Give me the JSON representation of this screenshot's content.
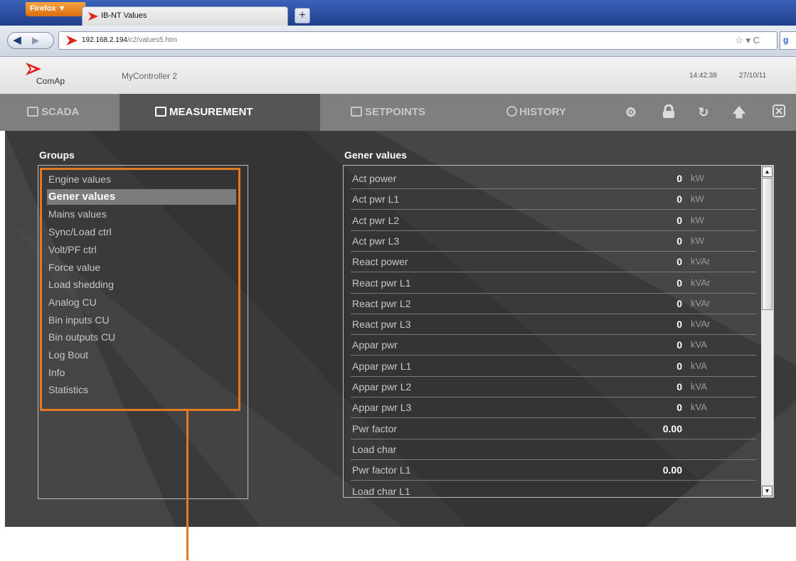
{
  "browser": {
    "menu_button": "Firefox ▼",
    "tab_title": "IB-NT Values",
    "new_tab": "+",
    "url_host": "192.168.2.194",
    "url_path": "/c2/values5.htm",
    "url_tools": "☆ ▾ C"
  },
  "header": {
    "logo_text": "ComAp",
    "controller_name": "MyController 2",
    "time": "14:42:38",
    "date": "27/10/11"
  },
  "nav": {
    "tabs": [
      {
        "label": "SCADA"
      },
      {
        "label": "MEASUREMENT"
      },
      {
        "label": "SETPOINTS"
      },
      {
        "label": "HISTORY"
      }
    ]
  },
  "groups": {
    "title": "Groups",
    "selected": "Gener values",
    "items": [
      "Engine values",
      "Gener values",
      "Mains values",
      "Sync/Load ctrl",
      "Volt/PF ctrl",
      "Force value",
      "Load shedding",
      "Analog CU",
      "Bin inputs CU",
      "Bin outputs CU",
      "Log Bout",
      "Info",
      "Statistics"
    ]
  },
  "values": {
    "title": "Gener values",
    "rows": [
      {
        "name": "Act power",
        "value": "0",
        "unit": "kW"
      },
      {
        "name": "Act pwr L1",
        "value": "0",
        "unit": "kW"
      },
      {
        "name": "Act pwr L2",
        "value": "0",
        "unit": "kW"
      },
      {
        "name": "Act pwr L3",
        "value": "0",
        "unit": "kW"
      },
      {
        "name": "React power",
        "value": "0",
        "unit": "kVAr"
      },
      {
        "name": "React pwr L1",
        "value": "0",
        "unit": "kVAr"
      },
      {
        "name": "React pwr L2",
        "value": "0",
        "unit": "kVAr"
      },
      {
        "name": "React pwr L3",
        "value": "0",
        "unit": "kVAr"
      },
      {
        "name": "Appar pwr",
        "value": "0",
        "unit": "kVA"
      },
      {
        "name": "Appar pwr L1",
        "value": "0",
        "unit": "kVA"
      },
      {
        "name": "Appar pwr L2",
        "value": "0",
        "unit": "kVA"
      },
      {
        "name": "Appar pwr L3",
        "value": "0",
        "unit": "kVA"
      },
      {
        "name": "Pwr factor",
        "value": "0.00",
        "unit": ""
      },
      {
        "name": "Load char",
        "value": "",
        "unit": ""
      },
      {
        "name": "Pwr factor L1",
        "value": "0.00",
        "unit": ""
      },
      {
        "name": "Load char L1",
        "value": "",
        "unit": ""
      }
    ]
  },
  "colors": {
    "accent_orange": "#e07a24",
    "nav_bg": "#7f7f7f",
    "nav_active_bg": "#555555",
    "content_bg": "#3a3a3a"
  }
}
